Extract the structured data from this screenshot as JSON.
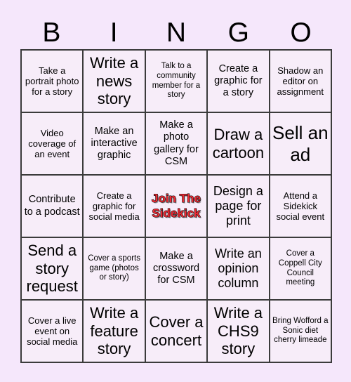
{
  "title": "BINGO",
  "header": {
    "letters": [
      "B",
      "I",
      "N",
      "G",
      "O"
    ]
  },
  "colors": {
    "page_background": "#f5e7fb",
    "cell_background": "#f7edf9",
    "grid_line": "#3b3b3b",
    "text": "#000000",
    "free_space_text": "#ee2b34",
    "free_space_outline": "#000000"
  },
  "grid": {
    "columns": 5,
    "rows": 5,
    "cells": [
      {
        "id": "b1",
        "text": "Take a portrait photo for a story",
        "size": "sm",
        "free": false
      },
      {
        "id": "i1",
        "text": "Write a news story",
        "size": "xl",
        "free": false
      },
      {
        "id": "n1",
        "text": "Talk to a community member for a story",
        "size": "xs",
        "free": false
      },
      {
        "id": "g1",
        "text": "Create a graphic for a story",
        "size": "md",
        "free": false
      },
      {
        "id": "o1",
        "text": "Shadow an editor on assignment",
        "size": "sm",
        "free": false
      },
      {
        "id": "b2",
        "text": "Video coverage of an event",
        "size": "sm",
        "free": false
      },
      {
        "id": "i2",
        "text": "Make an interactive graphic",
        "size": "md",
        "free": false
      },
      {
        "id": "n2",
        "text": "Make a photo gallery for CSM",
        "size": "md",
        "free": false
      },
      {
        "id": "g2",
        "text": "Draw a cartoon",
        "size": "xl",
        "free": false
      },
      {
        "id": "o2",
        "text": "Sell an ad",
        "size": "xxl",
        "free": false
      },
      {
        "id": "b3",
        "text": "Contribute to a podcast",
        "size": "md",
        "free": false
      },
      {
        "id": "i3",
        "text": "Create a graphic for social media",
        "size": "sm",
        "free": false
      },
      {
        "id": "n3",
        "text": "Join The Sidekick",
        "size": "free",
        "free": true
      },
      {
        "id": "g3",
        "text": "Design a page for print",
        "size": "lg",
        "free": false
      },
      {
        "id": "o3",
        "text": "Attend a Sidekick social event",
        "size": "sm",
        "free": false
      },
      {
        "id": "b4",
        "text": "Send a story request",
        "size": "xl",
        "free": false
      },
      {
        "id": "i4",
        "text": "Cover a sports game (photos or story)",
        "size": "xs",
        "free": false
      },
      {
        "id": "n4",
        "text": "Make a crossword for CSM",
        "size": "md",
        "free": false
      },
      {
        "id": "g4",
        "text": "Write an opinion column",
        "size": "lg",
        "free": false
      },
      {
        "id": "o4",
        "text": "Cover a Coppell City Council meeting",
        "size": "xs",
        "free": false
      },
      {
        "id": "b5",
        "text": "Cover a live event on social media",
        "size": "sm",
        "free": false
      },
      {
        "id": "i5",
        "text": "Write a feature story",
        "size": "xl",
        "free": false
      },
      {
        "id": "n5",
        "text": "Cover a concert",
        "size": "xl",
        "free": false
      },
      {
        "id": "g5",
        "text": "Write a CHS9 story",
        "size": "xl",
        "free": false
      },
      {
        "id": "o5",
        "text": "Bring Wofford a Sonic diet cherry limeade",
        "size": "xs",
        "free": false
      }
    ]
  }
}
